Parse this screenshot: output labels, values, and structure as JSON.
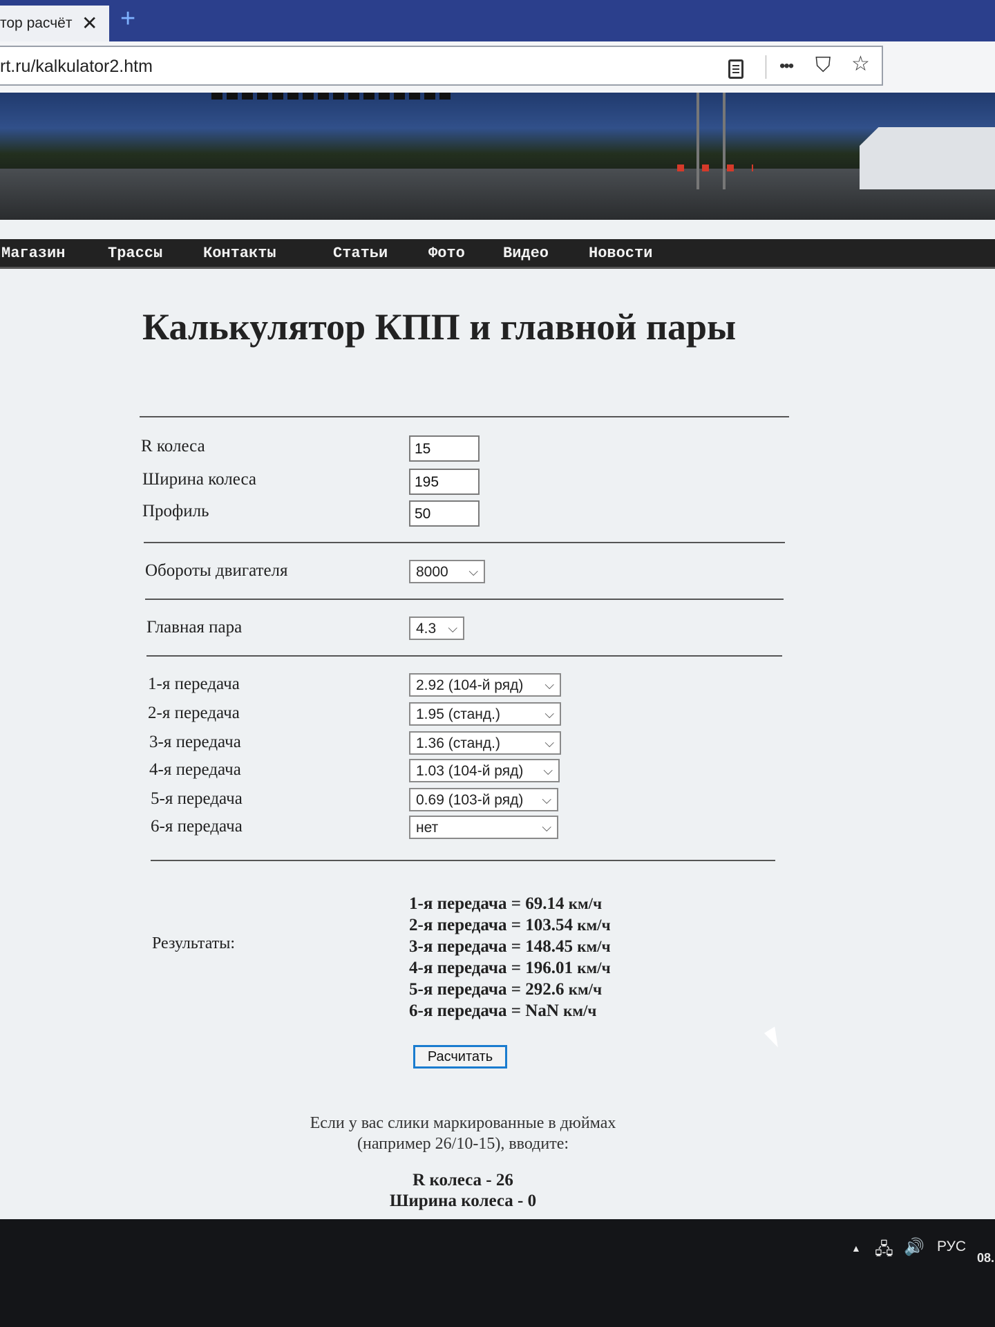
{
  "browser": {
    "tab_title": "тор расчёт",
    "tab_close": "✕",
    "new_tab": "+",
    "url": "rt.ru/kalkulator2.htm",
    "more": "•••",
    "pocket": "⛉",
    "bookmark": "☆"
  },
  "nav": {
    "items": [
      "Магазин",
      "Трассы",
      "Контакты",
      "Статьи",
      "Фото",
      "Видео",
      "Новости"
    ]
  },
  "page": {
    "title": "Калькулятор КПП и главной пары",
    "wheel": {
      "radius_label": "R колеса",
      "radius_value": "15",
      "width_label": "Ширина колеса",
      "width_value": "195",
      "profile_label": "Профиль",
      "profile_value": "50"
    },
    "engine": {
      "label": "Обороты двигателя",
      "value": "8000"
    },
    "final_drive": {
      "label": "Главная пара",
      "value": "4.3"
    },
    "gears": [
      {
        "label": "1-я передача",
        "value": "2.92 (104-й ряд)"
      },
      {
        "label": "2-я передача",
        "value": "1.95 (станд.)"
      },
      {
        "label": "3-я передача",
        "value": "1.36 (станд.)"
      },
      {
        "label": "4-я передача",
        "value": "1.03 (104-й ряд)"
      },
      {
        "label": "5-я передача",
        "value": "0.69 (103-й ряд)"
      },
      {
        "label": "6-я передача",
        "value": "нет"
      }
    ],
    "results_label": "Результаты:",
    "results": [
      {
        "text": "1-я передача = 69.14",
        "unit": "км/ч"
      },
      {
        "text": "2-я передача = 103.54",
        "unit": "км/ч"
      },
      {
        "text": "3-я передача = 148.45",
        "unit": "км/ч"
      },
      {
        "text": "4-я передача = 196.01",
        "unit": "км/ч"
      },
      {
        "text": "5-я передача = 292.6",
        "unit": "км/ч"
      },
      {
        "text": "6-я передача = NaN",
        "unit": "км/ч"
      }
    ],
    "calc_button": "Расчитать",
    "note_line1": "Если у вас слики маркированные в дюймах",
    "note_line2": "(например 26/10-15), вводите:",
    "note_radius": "R колеса - 26",
    "note_width": "Ширина колеса - 0"
  },
  "taskbar": {
    "tray_arrow": "▲",
    "lang": "РУС",
    "clock_fragment": "08."
  }
}
